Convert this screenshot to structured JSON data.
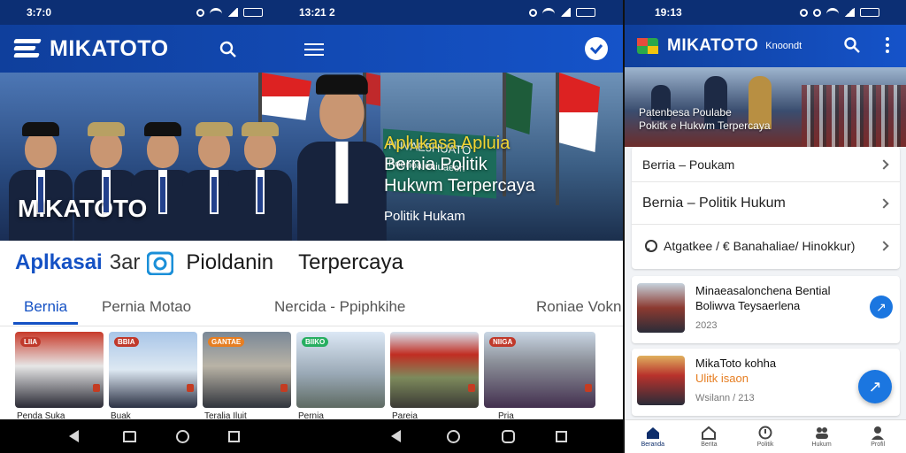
{
  "left": {
    "status_left": {
      "time": "3:7:0"
    },
    "status_mid": {
      "time": "13:21 2"
    },
    "brand": "MIKATOTO",
    "hero": {
      "overlay_brand": "MIKATOTO",
      "banner_line1": "NIIVAE5HUATO",
      "banner_line2": "Poenoa eniuaeon",
      "headline_yellow": "Aplukasa Apluia",
      "headline_line2": "Bernia Politik",
      "headline_line3": "Hukwm Terpercaya",
      "subtitle": "Politik Hukam"
    },
    "tagline": {
      "word1": "Aplkasai",
      "word2": "3ar",
      "word3": "Pioldanin",
      "word4": "Terpercaya"
    },
    "tabs": [
      "Bernia",
      "Pernia Motao",
      "Nercida  -  Ppiphkihe",
      "Roniae Vokn"
    ],
    "thumbs": [
      {
        "badge": "LIIA",
        "badge_color": "#c0392b",
        "caption": "Penda Suka"
      },
      {
        "badge": "BBIA",
        "badge_color": "#c0392b",
        "caption": "Buak"
      },
      {
        "badge": "GANTAE",
        "badge_color": "#e67e22",
        "caption": "Teralia Iluit"
      },
      {
        "badge": "BIIKO",
        "badge_color": "#27ae60",
        "caption": "Pernia"
      },
      {
        "badge": "",
        "badge_color": "#c0392b",
        "caption": "Pareia"
      },
      {
        "badge": "NIIGA",
        "badge_color": "#c0392b",
        "caption": "Pria"
      }
    ]
  },
  "right": {
    "status": {
      "time": "19:13"
    },
    "brand": "MIKATOTO",
    "brand_tag": "Knoondt",
    "hero_text_line1": "Patenbesa Poulabe",
    "hero_text_line2": "Pokitk e  Hukwm Terpercaya",
    "menu": {
      "row1": "Berria  –  Poukam",
      "row2": "Bernia  –  Politik Hukum",
      "row3": "Atgatkee / € Banahaliae/ Hinokkur)"
    },
    "news": [
      {
        "title_line1": "Minaeasalonchena Bential",
        "title_line2": "Boliwva Teysaerlena",
        "meta": "2023"
      },
      {
        "title_line1": "MikaToto kohha",
        "title_line2": "Ulitk isaon",
        "meta": "Wsilann / 213"
      }
    ],
    "bottom_nav": [
      "Beranda",
      "Berita",
      "Politik",
      "Hukum",
      "Profil"
    ]
  },
  "colors": {
    "primary": "#1451c4",
    "appbar": "#0f3f9c",
    "fab": "#1b76e0"
  }
}
